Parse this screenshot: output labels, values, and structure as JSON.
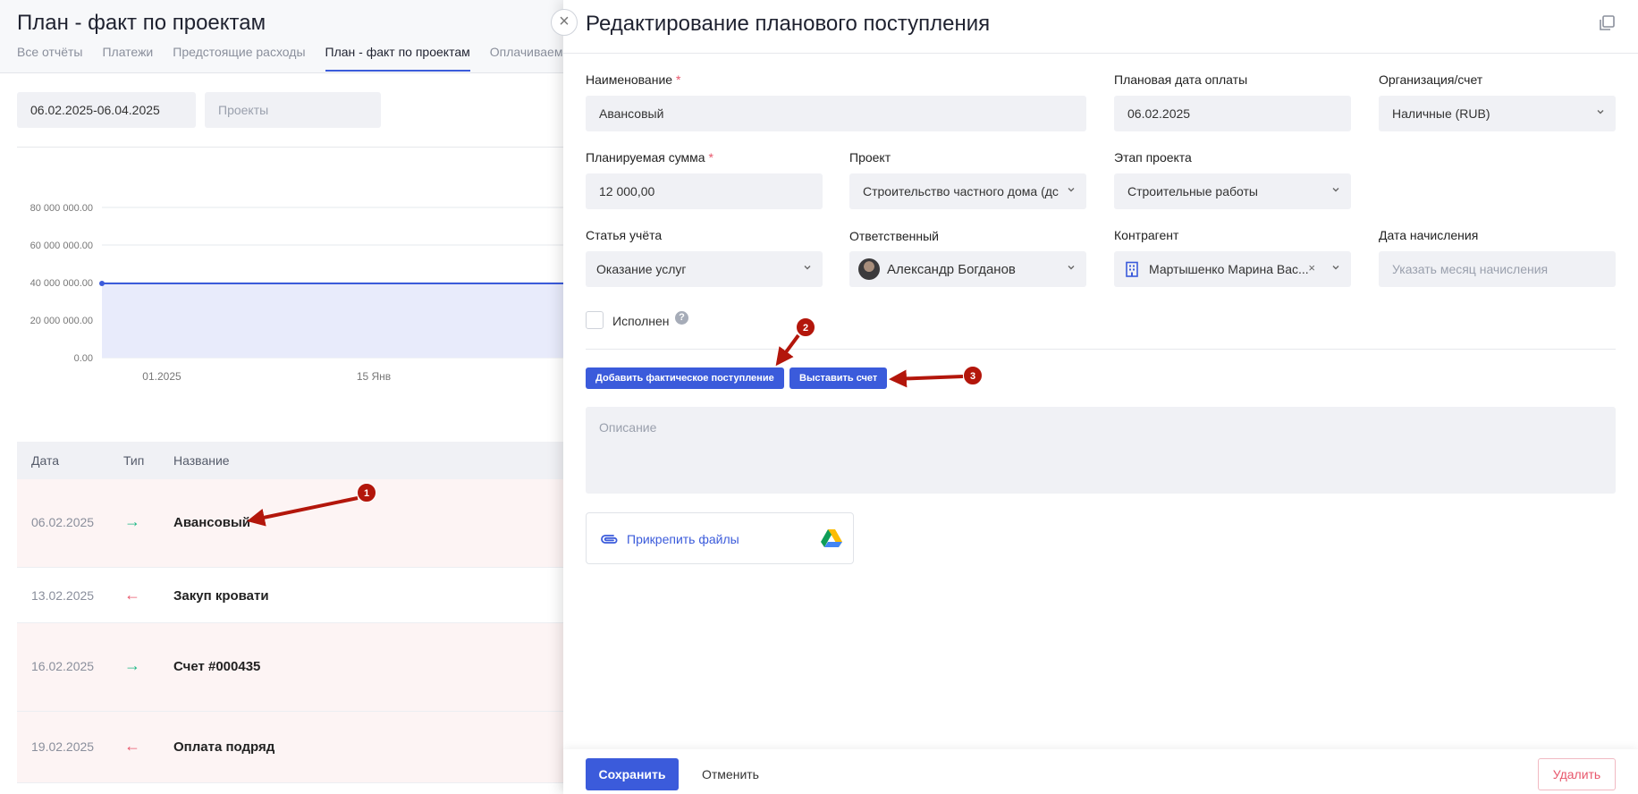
{
  "background": {
    "title": "План - факт по проектам",
    "tabs": [
      "Все отчёты",
      "Платежи",
      "Предстоящие расходы",
      "План - факт по проектам",
      "Оплачиваемы"
    ],
    "active_tab": "План - факт по проектам",
    "filters": {
      "date_range": "06.02.2025-06.04.2025",
      "projects_placeholder": "Проекты"
    },
    "chart": {
      "y_ticks": [
        "80 000 000.00",
        "60 000 000.00",
        "40 000 000.00",
        "20 000 000.00",
        "0.00"
      ],
      "x_ticks": [
        "01.2025",
        "15 Янв"
      ],
      "line_color": "#3b5bdb",
      "fill_color": "#e8ebfb"
    },
    "table": {
      "headers": [
        "Дата",
        "Тип",
        "Название"
      ],
      "rows": [
        {
          "date": "06.02.2025",
          "type": "in",
          "type_icon": "arrow-right-icon",
          "name": "Авансовый"
        },
        {
          "date": "13.02.2025",
          "type": "out",
          "type_icon": "arrow-left-icon",
          "name": "Закуп кровати"
        },
        {
          "date": "16.02.2025",
          "type": "in",
          "type_icon": "arrow-right-icon",
          "name": "Счет #000435"
        },
        {
          "date": "19.02.2025",
          "type": "out",
          "type_icon": "arrow-left-icon",
          "name": "Оплата подряд"
        }
      ]
    }
  },
  "drawer": {
    "title": "Редактирование планового поступления",
    "fields": {
      "name": {
        "label": "Наименование",
        "value": "Авансовый",
        "required": "*"
      },
      "plan_date": {
        "label": "Плановая дата оплаты",
        "value": "06.02.2025"
      },
      "org_account": {
        "label": "Организация/счет",
        "value": "Наличные (RUB)"
      },
      "plan_sum": {
        "label": "Планируемая сумма",
        "value": "12 000,00",
        "required": "*"
      },
      "project": {
        "label": "Проект",
        "value": "Строительство частного дома (дс"
      },
      "project_stage": {
        "label": "Этап проекта",
        "value": "Строительные работы"
      },
      "account_item": {
        "label": "Статья учёта",
        "value": "Оказание услуг"
      },
      "responsible": {
        "label": "Ответственный",
        "value": "Александр Богданов"
      },
      "counterparty": {
        "label": "Контрагент",
        "value": "Мартышенко Марина Вас...",
        "clear": "×"
      },
      "accrual_date": {
        "label": "Дата начисления",
        "placeholder": "Указать месяц начисления"
      }
    },
    "done": {
      "label": "Исполнен",
      "help": "?"
    },
    "buttons": {
      "add_actual": "Добавить фактическое поступление",
      "invoice": "Выставить счет"
    },
    "description_placeholder": "Описание",
    "attach_label": "Прикрепить файлы",
    "footer": {
      "save": "Сохранить",
      "cancel": "Отменить",
      "delete": "Удалить"
    }
  },
  "annotations": {
    "badge1": "1",
    "badge2": "2",
    "badge3": "3",
    "color": "#b3160b"
  }
}
